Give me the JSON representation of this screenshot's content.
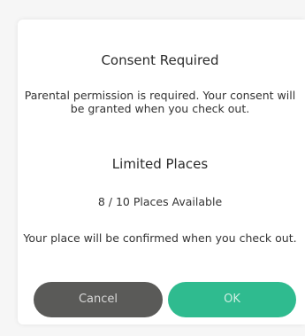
{
  "dialog": {
    "title": "Consent Required",
    "consent_message": "Parental permission is required. Your consent will be granted when you check out.",
    "subtitle": "Limited Places",
    "availability": "8 / 10 Places Available",
    "confirm_message": "Your place will be confirmed when you check out."
  },
  "buttons": {
    "cancel_label": "Cancel",
    "ok_label": "OK"
  },
  "colors": {
    "cancel_bg": "#5a5a58",
    "ok_bg": "#2fbb8f",
    "card_bg": "#ffffff"
  }
}
